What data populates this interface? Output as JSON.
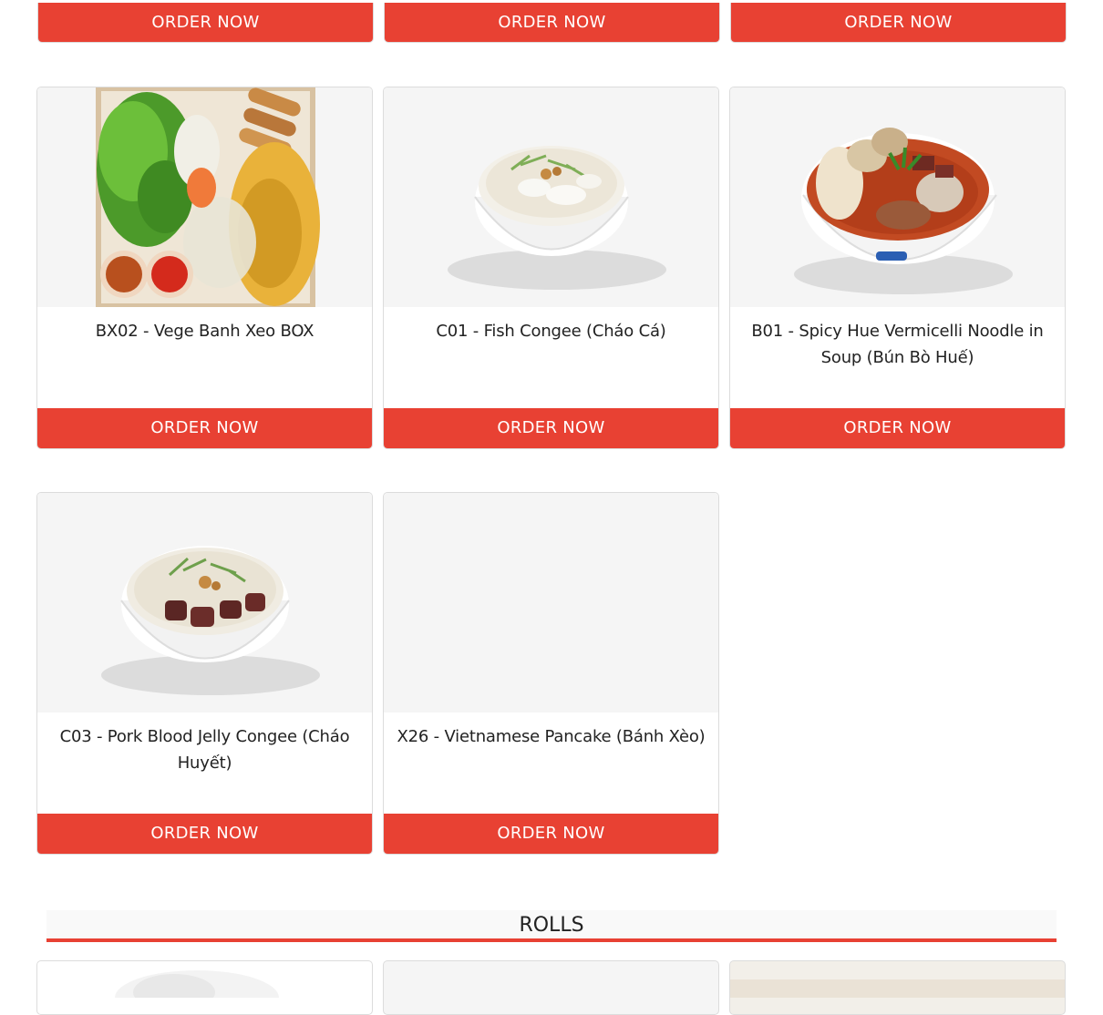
{
  "top_row": {
    "buttons": [
      "ORDER NOW",
      "ORDER NOW",
      "ORDER NOW"
    ]
  },
  "menu_items": [
    {
      "name": "BX02 - Vege Banh Xeo BOX",
      "button": "ORDER NOW",
      "image": "banh-xeo-box-image"
    },
    {
      "name": "C01 - Fish Congee (Cháo Cá)",
      "button": "ORDER NOW",
      "image": "fish-congee-image"
    },
    {
      "name": "B01 - Spicy Hue Vermicelli Noodle in Soup (Bún Bò Huế)",
      "button": "ORDER NOW",
      "image": "bun-bo-hue-image"
    },
    {
      "name": "C03 - Pork Blood Jelly Congee (Cháo Huyết)",
      "button": "ORDER NOW",
      "image": "pork-blood-congee-image"
    },
    {
      "name": "X26 - Vietnamese Pancake (Bánh Xèo)",
      "button": "ORDER NOW",
      "image": ""
    }
  ],
  "section": {
    "title": "ROLLS"
  },
  "colors": {
    "accent": "#e84133",
    "image_bg": "#f5f5f5",
    "border": "#dcdcdc"
  }
}
